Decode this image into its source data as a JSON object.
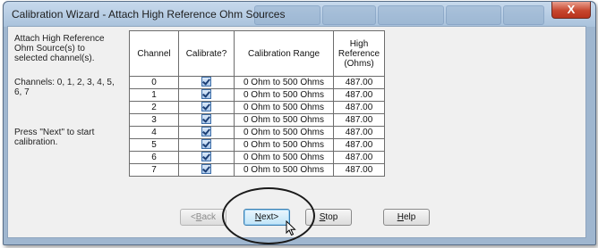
{
  "window": {
    "title": "Calibration Wizard - Attach High Reference Ohm Sources",
    "close_label": "X"
  },
  "instructions": {
    "attach": "Attach High Reference Ohm Source(s) to selected channel(s).",
    "channels": "Channels: 0, 1, 2, 3, 4, 5, 6, 7",
    "press": "Press \"Next\" to start calibration."
  },
  "table": {
    "headers": {
      "channel": "Channel",
      "calibrate": "Calibrate?",
      "range": "Calibration Range",
      "reference": "High Reference (Ohms)"
    },
    "rows": [
      {
        "channel": "0",
        "calibrate": true,
        "range": "0 Ohm to 500 Ohms",
        "reference": "487.00"
      },
      {
        "channel": "1",
        "calibrate": true,
        "range": "0 Ohm to 500 Ohms",
        "reference": "487.00"
      },
      {
        "channel": "2",
        "calibrate": true,
        "range": "0 Ohm to 500 Ohms",
        "reference": "487.00"
      },
      {
        "channel": "3",
        "calibrate": true,
        "range": "0 Ohm to 500 Ohms",
        "reference": "487.00"
      },
      {
        "channel": "4",
        "calibrate": true,
        "range": "0 Ohm to 500 Ohms",
        "reference": "487.00"
      },
      {
        "channel": "5",
        "calibrate": true,
        "range": "0 Ohm to 500 Ohms",
        "reference": "487.00"
      },
      {
        "channel": "6",
        "calibrate": true,
        "range": "0 Ohm to 500 Ohms",
        "reference": "487.00"
      },
      {
        "channel": "7",
        "calibrate": true,
        "range": "0 Ohm to 500 Ohms",
        "reference": "487.00"
      }
    ]
  },
  "buttons": {
    "back": {
      "mnemonic": "B",
      "rest": "ack",
      "disabled": true
    },
    "next": {
      "mnemonic": "N",
      "rest": "ext>",
      "default": true
    },
    "stop": {
      "mnemonic": "S",
      "rest": "top"
    },
    "help": {
      "mnemonic": "H",
      "rest": "elp"
    }
  },
  "icons": {
    "checkbox": "checkbox-checked-icon",
    "cursor": "mouse-pointer-icon",
    "highlight": "callout-ellipse"
  }
}
